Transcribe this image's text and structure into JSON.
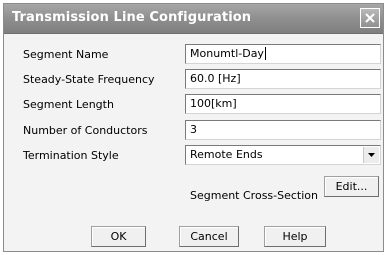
{
  "window": {
    "title": "Transmission Line Configuration"
  },
  "form": {
    "segment_name": {
      "label": "Segment Name",
      "value": "Monumtl-Day"
    },
    "frequency": {
      "label": "Steady-State Frequency",
      "value": "60.0 [Hz]"
    },
    "length": {
      "label": "Segment Length",
      "value": "100[km]"
    },
    "conductors": {
      "label": "Number of Conductors",
      "value": "3"
    },
    "termination": {
      "label": "Termination Style",
      "value": "Remote Ends"
    }
  },
  "cross_section": {
    "label": "Segment Cross-Section",
    "edit_label": "Edit..."
  },
  "buttons": {
    "ok": "OK",
    "cancel": "Cancel",
    "help": "Help"
  },
  "icons": {
    "close": "close-icon",
    "dropdown": "chevron-down-icon"
  }
}
